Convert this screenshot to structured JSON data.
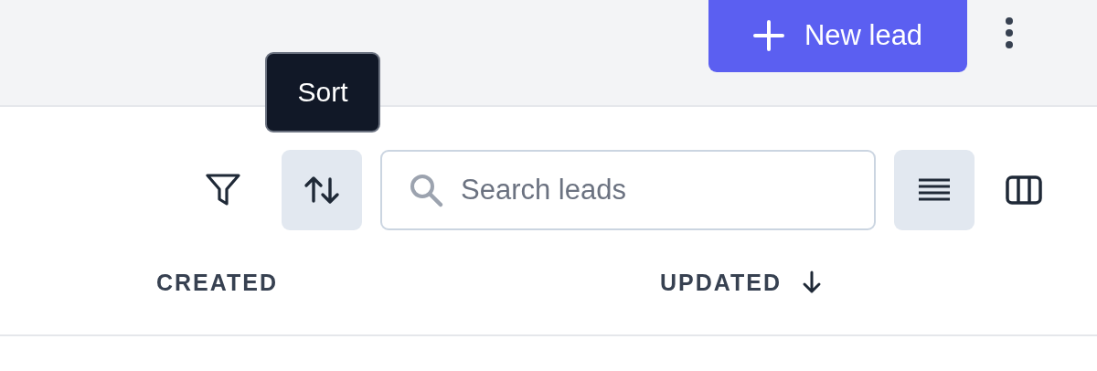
{
  "header": {
    "primary_button": {
      "label": "New lead"
    }
  },
  "toolbar": {
    "sort_button": {
      "hovered": true,
      "tooltip": "Sort"
    },
    "search": {
      "placeholder": "Search leads"
    },
    "views": [
      {
        "kind": "list",
        "selected": true
      },
      {
        "kind": "columns",
        "selected": false
      }
    ]
  },
  "table": {
    "columns": [
      {
        "label": "CREATED",
        "sorted": false
      },
      {
        "label": "UPDATED",
        "sorted": true
      }
    ]
  }
}
